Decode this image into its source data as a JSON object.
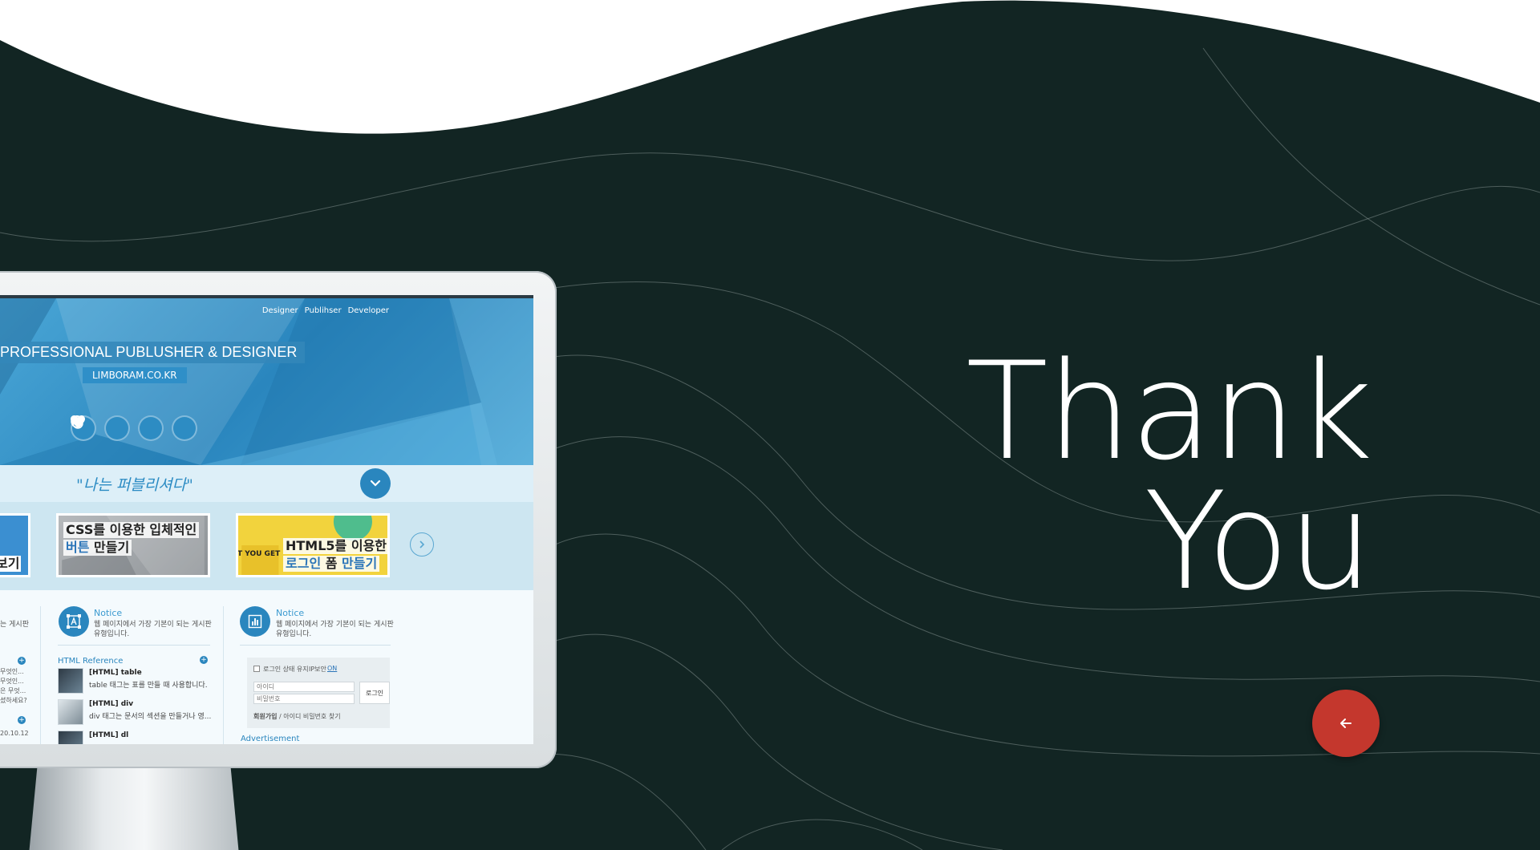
{
  "headline": {
    "line1": "Thank",
    "line2": "You"
  },
  "back_button": {
    "icon": "arrow-left-icon",
    "color": "#c4372d"
  },
  "colors": {
    "background": "#122523",
    "accent": "#2a86be",
    "button": "#c4372d"
  },
  "screen": {
    "nav": [
      "Designer",
      "Publihser",
      "Developer"
    ],
    "hero_title": "PROFESSIONAL PUBLUSHER & DESIGNER",
    "hero_subtitle": "LIMBORAM.CO.KR",
    "hero_icons": [
      "record-icon",
      "heart-icon",
      "at-icon",
      "alarm-clock-icon"
    ],
    "slogan": "\"나는 퍼블리셔다\"",
    "slides": [
      {
        "line2": "보기"
      },
      {
        "line1": "CSS를 이용한 입체적인",
        "line2_hl": "버튼",
        "line2": " 만들기"
      },
      {
        "line1": "HTML5를 이용한",
        "line2_a": "로그인 ",
        "line2_hl": "폼",
        "line2_b": " 만들기",
        "side": "T YOU GET"
      }
    ],
    "left_column": {
      "desc": "는 게시판",
      "lines": [
        "무엇인...",
        "무엇인...",
        "은 무엇...",
        "셨하세요?",
        "20.10.12"
      ]
    },
    "notice1": {
      "title": "Notice",
      "desc1": "웹 페이지에서 가장 기본이 되는 게시판",
      "desc2": "유형입니다.",
      "section": "HTML Reference",
      "items": [
        {
          "title": "[HTML] table",
          "desc": "table 태그는 표를 만들 때 사용합니다."
        },
        {
          "title": "[HTML] div",
          "desc": "div 태그는 문서의 섹션을 만들거나 영..."
        },
        {
          "title": "[HTML] dl",
          "desc": ""
        }
      ]
    },
    "notice2": {
      "title": "Notice",
      "desc1": "웹 페이지에서 가장 기본이 되는 게시판",
      "desc2": "유형입니다.",
      "login": {
        "keep": "로그인 상태 유지",
        "security_label": "IP보안",
        "security_value": "ON",
        "id_placeholder": "아이디",
        "pw_placeholder": "비밀번호",
        "button": "로그인",
        "signup": "회원가입",
        "find": " / 아이디 비밀번호 찾기"
      },
      "advertisement": "Advertisement"
    }
  }
}
